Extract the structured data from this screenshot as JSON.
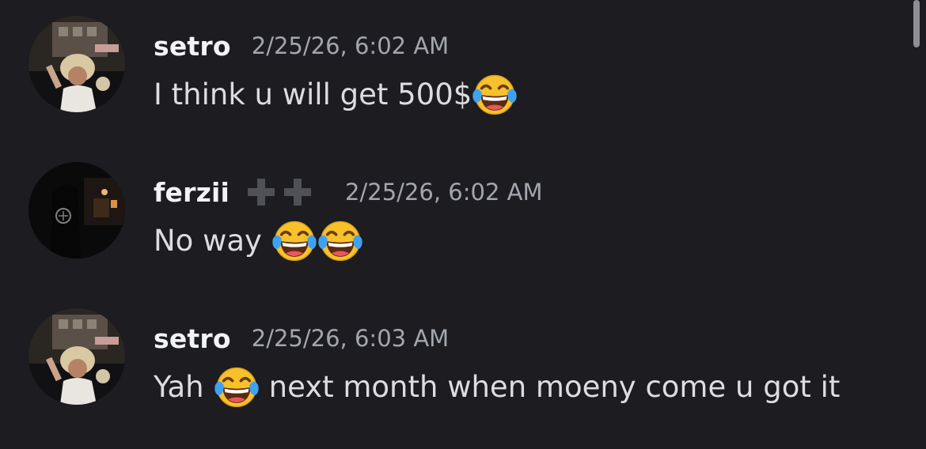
{
  "messages": [
    {
      "username": "setro",
      "timestamp": "2/25/26, 6:02 AM",
      "text_before": "I think u will get 500$",
      "text_after": "",
      "emoji": "face-with-tears-of-joy"
    },
    {
      "username": "ferzii",
      "badges": [
        "plus-badge",
        "plus-badge"
      ],
      "timestamp": "2/25/26, 6:02 AM",
      "text_before": "No way",
      "text_after": "",
      "emoji": "face-with-tears-of-joy"
    },
    {
      "username": "setro",
      "timestamp": "2/25/26, 6:03 AM",
      "text_before": "Yah",
      "text_after": "next month when moeny come u got it",
      "emoji": "face-with-tears-of-joy"
    }
  ],
  "colors": {
    "background": "#1c1c21",
    "username": "#f2f3f5",
    "timestamp": "#a3a6ad",
    "message_text": "#dcdde0",
    "badge": "#4f5157",
    "emoji_face": "#f7c12c"
  }
}
